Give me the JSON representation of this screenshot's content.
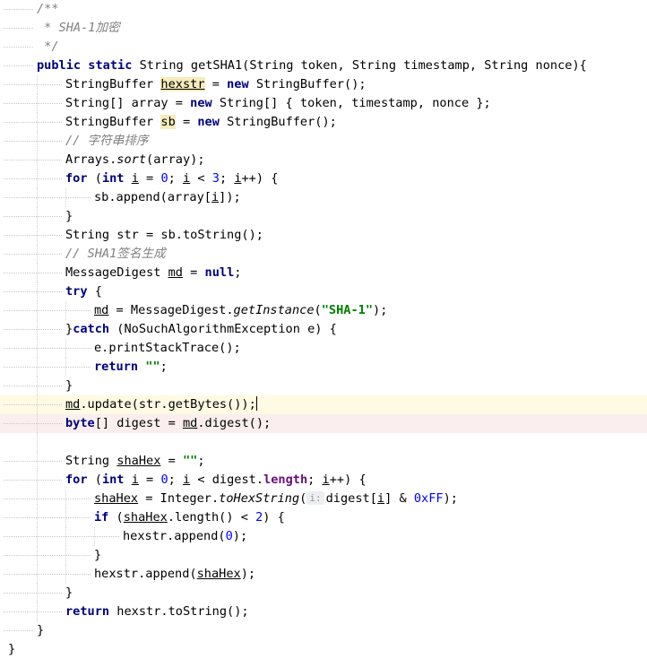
{
  "editor": {
    "language": "Java",
    "colors": {
      "keyword": "#000080",
      "comment": "#808080",
      "string": "#008000",
      "number": "#0000ff",
      "field": "#660e7a",
      "current_line": "#fffae3",
      "error_line": "#fbeeee",
      "identifier_highlight": "#f6ebbc"
    },
    "lines": [
      {
        "indent": 1,
        "tokens": [
          [
            "/**",
            "cm"
          ]
        ]
      },
      {
        "indent": 1,
        "tokens": [
          [
            " * SHA-1加密",
            "cm"
          ]
        ]
      },
      {
        "indent": 1,
        "tokens": [
          [
            " */",
            "cm"
          ]
        ]
      },
      {
        "indent": 1,
        "tokens": [
          [
            "public static",
            "kw"
          ],
          [
            " String getSHA1(String token, String timestamp, String nonce){",
            ""
          ]
        ]
      },
      {
        "indent": 2,
        "tokens": [
          [
            "StringBuffer ",
            ""
          ],
          [
            "hexstr",
            "hl ul"
          ],
          [
            " = ",
            ""
          ],
          [
            "new",
            "kw"
          ],
          [
            " StringBuffer();",
            ""
          ]
        ]
      },
      {
        "indent": 2,
        "tokens": [
          [
            "String[] array = ",
            ""
          ],
          [
            "new",
            "kw"
          ],
          [
            " String[] { token, timestamp, nonce };",
            ""
          ]
        ]
      },
      {
        "indent": 2,
        "tokens": [
          [
            "StringBuffer ",
            ""
          ],
          [
            "sb",
            "hl"
          ],
          [
            " = ",
            ""
          ],
          [
            "new",
            "kw"
          ],
          [
            " StringBuffer();",
            ""
          ]
        ]
      },
      {
        "indent": 2,
        "tokens": [
          [
            "// 字符串排序",
            "cm"
          ]
        ]
      },
      {
        "indent": 2,
        "tokens": [
          [
            "Arrays.",
            ""
          ],
          [
            "sort",
            "st"
          ],
          [
            "(array);",
            ""
          ]
        ]
      },
      {
        "indent": 2,
        "tokens": [
          [
            "for",
            "kw"
          ],
          [
            " (",
            ""
          ],
          [
            "int",
            "kw"
          ],
          [
            " ",
            ""
          ],
          [
            "i",
            "ul"
          ],
          [
            " = ",
            ""
          ],
          [
            "0",
            "num"
          ],
          [
            "; ",
            ""
          ],
          [
            "i",
            "ul"
          ],
          [
            " < ",
            ""
          ],
          [
            "3",
            "num"
          ],
          [
            "; ",
            ""
          ],
          [
            "i",
            "ul"
          ],
          [
            "++) {",
            ""
          ]
        ]
      },
      {
        "indent": 3,
        "tokens": [
          [
            "sb.append(array[",
            ""
          ],
          [
            "i",
            "ul"
          ],
          [
            "]);",
            ""
          ]
        ]
      },
      {
        "indent": 2,
        "tokens": [
          [
            "}",
            ""
          ]
        ]
      },
      {
        "indent": 2,
        "tokens": [
          [
            "String str = sb.toString();",
            ""
          ]
        ]
      },
      {
        "indent": 2,
        "tokens": [
          [
            "// SHA1签名生成",
            "cm"
          ]
        ]
      },
      {
        "indent": 2,
        "tokens": [
          [
            "MessageDigest ",
            ""
          ],
          [
            "md",
            "ul"
          ],
          [
            " = ",
            ""
          ],
          [
            "null",
            "kw"
          ],
          [
            ";",
            ""
          ]
        ]
      },
      {
        "indent": 2,
        "tokens": [
          [
            "try",
            "kw"
          ],
          [
            " {",
            ""
          ]
        ]
      },
      {
        "indent": 3,
        "tokens": [
          [
            "md",
            "ul"
          ],
          [
            " = MessageDigest.",
            ""
          ],
          [
            "getInstance",
            "st"
          ],
          [
            "(",
            ""
          ],
          [
            "\"SHA-1\"",
            "str"
          ],
          [
            ");",
            ""
          ]
        ]
      },
      {
        "indent": 2,
        "tokens": [
          [
            "}",
            ""
          ],
          [
            "catch",
            "kw"
          ],
          [
            " (NoSuchAlgorithmException e) {",
            ""
          ]
        ]
      },
      {
        "indent": 3,
        "tokens": [
          [
            "e.printStackTrace();",
            ""
          ]
        ]
      },
      {
        "indent": 3,
        "tokens": [
          [
            "return",
            "kw"
          ],
          [
            " ",
            ""
          ],
          [
            "\"\"",
            "str"
          ],
          [
            ";",
            ""
          ]
        ]
      },
      {
        "indent": 2,
        "tokens": [
          [
            "}",
            ""
          ]
        ]
      },
      {
        "indent": 2,
        "state": "current",
        "caret": true,
        "tokens": [
          [
            "md",
            "ul"
          ],
          [
            ".update(str.getBytes());",
            ""
          ]
        ]
      },
      {
        "indent": 2,
        "state": "error",
        "tokens": [
          [
            "byte",
            "kw"
          ],
          [
            "[] digest = ",
            ""
          ],
          [
            "md",
            "ul"
          ],
          [
            ".digest();",
            ""
          ]
        ]
      },
      {
        "indent": 2,
        "tokens": []
      },
      {
        "indent": 2,
        "tokens": [
          [
            "String ",
            ""
          ],
          [
            "shaHex",
            "ul"
          ],
          [
            " = ",
            ""
          ],
          [
            "\"\"",
            "str"
          ],
          [
            ";",
            ""
          ]
        ]
      },
      {
        "indent": 2,
        "tokens": [
          [
            "for",
            "kw"
          ],
          [
            " (",
            ""
          ],
          [
            "int",
            "kw"
          ],
          [
            " ",
            ""
          ],
          [
            "i",
            "ul"
          ],
          [
            " = ",
            ""
          ],
          [
            "0",
            "num"
          ],
          [
            "; ",
            ""
          ],
          [
            "i",
            "ul"
          ],
          [
            " < digest.",
            ""
          ],
          [
            "length",
            "fld"
          ],
          [
            "; ",
            ""
          ],
          [
            "i",
            "ul"
          ],
          [
            "++) {",
            ""
          ]
        ]
      },
      {
        "indent": 3,
        "tokens": [
          [
            "shaHex",
            "ul"
          ],
          [
            " = Integer.",
            ""
          ],
          [
            "toHexString",
            "st"
          ],
          [
            "(",
            ""
          ],
          [
            "i:",
            "hint"
          ],
          [
            "digest[",
            ""
          ],
          [
            "i",
            "ul"
          ],
          [
            "] & ",
            ""
          ],
          [
            "0xFF",
            "num"
          ],
          [
            ");",
            ""
          ]
        ]
      },
      {
        "indent": 3,
        "tokens": [
          [
            "if",
            "kw"
          ],
          [
            " (",
            ""
          ],
          [
            "shaHex",
            "ul"
          ],
          [
            ".length() < ",
            ""
          ],
          [
            "2",
            "num"
          ],
          [
            ") {",
            ""
          ]
        ]
      },
      {
        "indent": 4,
        "tokens": [
          [
            "hexstr.append(",
            ""
          ],
          [
            "0",
            "num"
          ],
          [
            ");",
            ""
          ]
        ]
      },
      {
        "indent": 3,
        "tokens": [
          [
            "}",
            ""
          ]
        ]
      },
      {
        "indent": 3,
        "tokens": [
          [
            "hexstr.append(",
            ""
          ],
          [
            "shaHex",
            "ul"
          ],
          [
            ");",
            ""
          ]
        ]
      },
      {
        "indent": 2,
        "tokens": [
          [
            "}",
            ""
          ]
        ]
      },
      {
        "indent": 2,
        "tokens": [
          [
            "return",
            "kw"
          ],
          [
            " hexstr.toString();",
            ""
          ]
        ]
      },
      {
        "indent": 1,
        "tokens": [
          [
            "}",
            ""
          ]
        ]
      },
      {
        "indent": 0,
        "tokens": [
          [
            "}",
            ""
          ]
        ]
      }
    ]
  }
}
